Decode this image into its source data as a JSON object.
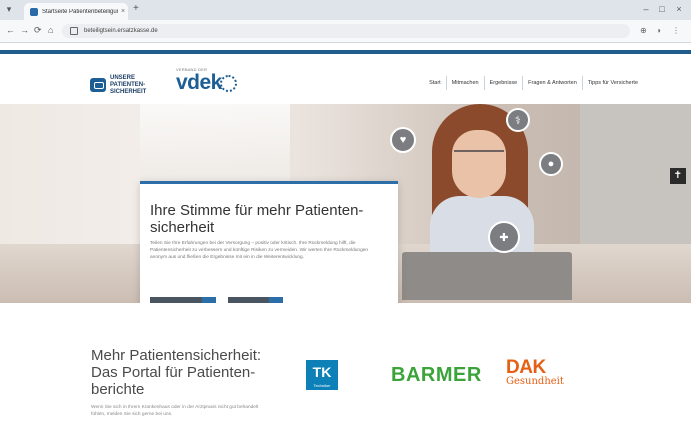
{
  "browser": {
    "tab_title": "Startseite Patientenbeteiligung",
    "tab_close": "×",
    "new_tab": "+",
    "url": "beteiligtsein.ersatzkasse.de",
    "back": "←",
    "forward": "→",
    "reload": "⟳",
    "home": "⌂",
    "win_min": "–",
    "win_max": "□",
    "win_close": "×"
  },
  "site": {
    "brand_ps_lines": [
      "UNSERE",
      "PATIENTEN-",
      "SICHERHEIT"
    ],
    "brand_vdek_small": "VERBAND DER",
    "brand_vdek": "vdek",
    "nav": [
      "Start",
      "Mitmachen",
      "Ergebnisse",
      "Fragen & Antworten",
      "Tipps für Versicherte"
    ]
  },
  "hero": {
    "title": "Ihre Stimme für mehr Patienten­sicherheit",
    "description": "Teilen Sie Ihre Erfahrungen bei der Versorgung – positiv oder kritisch. Ihre Rückmeldung hilft, die Patientensicherheit zu verbessern und künftige Risiken zu vermeiden. Wir werten Ihre Rückmeldungen anonym aus und fließen die Ergebnisse mit ein in die Weiterentwicklung.",
    "button_primary": "Jetzt teilnehmen",
    "button_secondary": "Mehr lesen",
    "arrow": "›"
  },
  "section2": {
    "title": "Mehr Patientensicherheit: Das Portal für Patienten­berichte",
    "text": "Wenn Sie sich in Ihrem Krankenhaus oder in der Arztpraxis nicht gut behandelt fühlen, melden Sie sich gerne bei uns."
  },
  "partners": {
    "tk": "TK",
    "tk_sub": "Techniker",
    "barmer": "BARMER",
    "dak": "DAK",
    "dak_sub": "Gesundheit"
  }
}
